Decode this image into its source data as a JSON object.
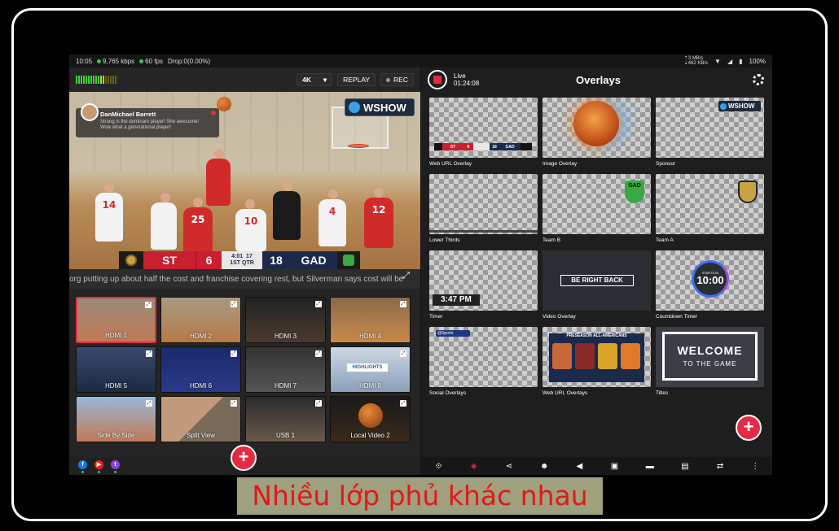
{
  "status_bar": {
    "time": "10:05",
    "bitrate": "9,765 kbps",
    "fps": "60 fps",
    "drop": "Drop:0(0.00%)",
    "net_up": "3 MB/s",
    "net_down": "462 KB/s",
    "battery": "100%"
  },
  "toolbar": {
    "resolution": "4K",
    "replay_label": "REPLAY",
    "rec_label": "REC"
  },
  "comment": {
    "name": "DanMichael Barrett",
    "message_line1": "Strong is the dominant player! She awesome!",
    "message_line2": "Wow what a generational player!"
  },
  "preview": {
    "sponsor": "WSHOW",
    "jerseys": [
      "14",
      "25",
      "10",
      "4",
      "12"
    ],
    "scorebug": {
      "team_a": "ST",
      "score_a": "6",
      "clock": "4:01",
      "shot": "17",
      "period": "1ST QTR",
      "score_b": "18",
      "team_b": "GAD"
    },
    "ticker": "org putting up about half the cost and franchise covering rest, but Silverman says cost will be"
  },
  "sources": [
    {
      "label": "HDMI 1",
      "selected": true
    },
    {
      "label": "HDMI 2"
    },
    {
      "label": "HDMI 3"
    },
    {
      "label": "HDMI 4"
    },
    {
      "label": "HDMI 5"
    },
    {
      "label": "HDMI 6"
    },
    {
      "label": "HDMI 7"
    },
    {
      "label": "HDMI 8"
    },
    {
      "label": "Side By Side"
    },
    {
      "label": "Split View"
    },
    {
      "label": "USB 1"
    },
    {
      "label": "Local Video 2"
    }
  ],
  "highlights_label": "HIGHLIGHTS",
  "social_icons": [
    "facebook-icon",
    "youtube-icon",
    "twitch-icon"
  ],
  "live": {
    "status": "Live",
    "duration": "01:24:08"
  },
  "overlays_title": "Overlays",
  "overlays": [
    {
      "name": "Web URL Overlay"
    },
    {
      "name": "Image Overlay"
    },
    {
      "name": "Sponsor"
    },
    {
      "name": "Lower Thirds"
    },
    {
      "name": "Team B"
    },
    {
      "name": "Team A"
    },
    {
      "name": "Timer"
    },
    {
      "name": "Video Overlay"
    },
    {
      "name": "Countdown Timer"
    },
    {
      "name": "Social Overlays"
    },
    {
      "name": "Web URL Overlays"
    },
    {
      "name": "Titles"
    }
  ],
  "overlay_content": {
    "mini_score": {
      "team_a": "ST",
      "score_a": "6",
      "score_b": "18",
      "team_b": "GAD"
    },
    "sponsor_text": "WSHOW",
    "team_b_logo": "GAD",
    "timer_value": "3:47 PM",
    "video_text": "BE RIGHT BACK",
    "countdown_label": "STARTS IN",
    "countdown_value": "10:00",
    "social_handle": "@Sports",
    "all_americans_title": "PRESEASON ALL-AMERICANS",
    "welcome_line1": "WELCOME",
    "welcome_line2": "TO THE GAME"
  },
  "caption": "Nhiều lớp phủ khác nhau",
  "colors": {
    "accent": "#e42b43",
    "scorebug_red": "#c7202e",
    "scorebug_navy": "#1b2a4a"
  }
}
